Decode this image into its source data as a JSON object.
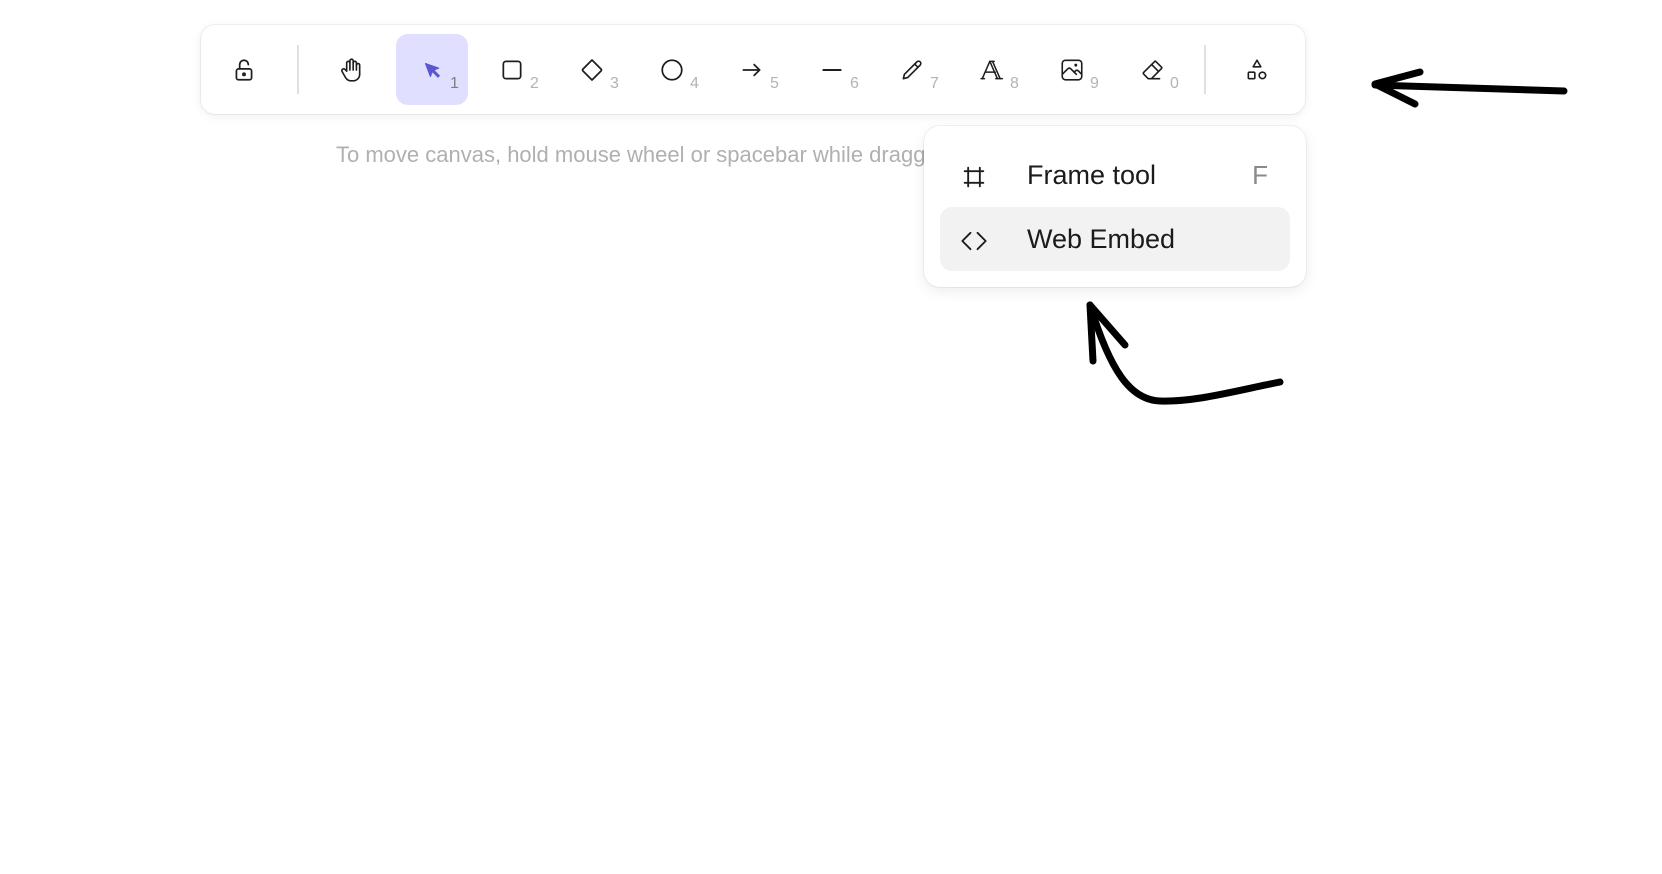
{
  "toolbar": {
    "tools": [
      {
        "name": "lock",
        "key": ""
      },
      {
        "name": "hand",
        "key": ""
      },
      {
        "name": "selection",
        "key": "1",
        "active": true
      },
      {
        "name": "rectangle",
        "key": "2"
      },
      {
        "name": "diamond",
        "key": "3"
      },
      {
        "name": "ellipse",
        "key": "4"
      },
      {
        "name": "arrow",
        "key": "5"
      },
      {
        "name": "line",
        "key": "6"
      },
      {
        "name": "draw",
        "key": "7"
      },
      {
        "name": "text",
        "key": "8"
      },
      {
        "name": "image",
        "key": "9"
      },
      {
        "name": "eraser",
        "key": "0"
      },
      {
        "name": "more-tools",
        "key": ""
      }
    ],
    "active_color": "#5b57d1",
    "active_bg": "#e0dfff"
  },
  "hint": {
    "text": "To move canvas, hold mouse wheel or spacebar while dragging, or use the hand tool"
  },
  "more_tools_menu": {
    "items": [
      {
        "label": "Frame tool",
        "shortcut": "F",
        "icon": "frame-icon"
      },
      {
        "label": "Web Embed",
        "shortcut": "",
        "icon": "embed-icon",
        "hovered": true
      }
    ]
  },
  "annotations": [
    {
      "type": "hand-drawn-arrow",
      "points_to": "more-tools-button"
    },
    {
      "type": "hand-drawn-arrow",
      "points_to": "web-embed-menu-item"
    }
  ]
}
